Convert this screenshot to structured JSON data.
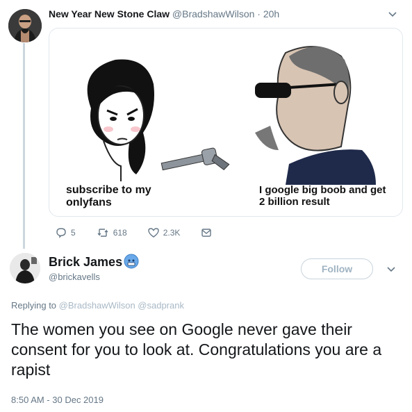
{
  "quoted_tweet": {
    "display_name": "New Year New Stone Claw",
    "handle": "@BradshawWilson",
    "separator": "·",
    "time": "20h",
    "meme": {
      "left_caption": "subscribe to my onlyfans",
      "right_caption": "I google big boob and get 2 billion result"
    },
    "actions": {
      "replies": "5",
      "retweets": "618",
      "likes": "2.3K"
    }
  },
  "reply_tweet": {
    "display_name": "Brick James",
    "badge_icon": "emoji-face-icon",
    "handle": "@brickavells",
    "follow_label": "Follow",
    "replying_prefix": "Replying to",
    "replying_to": "@BradshawWilson @sadprank",
    "text": "The women you see on Google never gave their consent for you to look at. Congratulations you are a rapist",
    "timestamp": "8:50 AM - 30 Dec 2019"
  },
  "colors": {
    "muted": "#657786",
    "thread_line": "#ccd6dd",
    "link": "#a9b9c6"
  }
}
